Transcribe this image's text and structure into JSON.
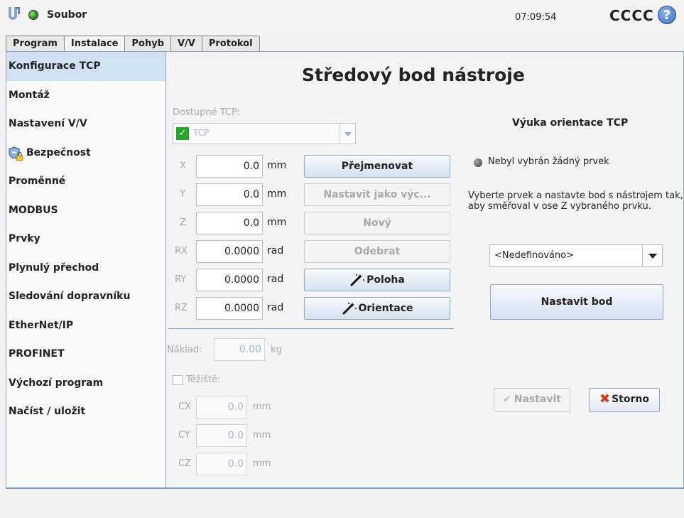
{
  "header": {
    "file_label": "Soubor",
    "clock": "07:09:54",
    "robot_name": "CCCC",
    "help_label": "?"
  },
  "tabs": [
    {
      "label": "Program",
      "active": false
    },
    {
      "label": "Instalace",
      "active": true
    },
    {
      "label": "Pohyb",
      "active": false
    },
    {
      "label": "V/V",
      "active": false
    },
    {
      "label": "Protokol",
      "active": false
    }
  ],
  "sidebar": {
    "items": [
      {
        "label": "Konfigurace TCP",
        "active": true
      },
      {
        "label": "Montáž"
      },
      {
        "label": "Nastavení V/V"
      },
      {
        "label": "Bezpečnost",
        "icon": "shield-lock-icon"
      },
      {
        "label": "Proměnné"
      },
      {
        "label": "MODBUS"
      },
      {
        "label": "Prvky"
      },
      {
        "label": "Plynulý přechod"
      },
      {
        "label": "Sledování dopravníku"
      },
      {
        "label": "EtherNet/IP"
      },
      {
        "label": "PROFINET"
      },
      {
        "label": "Výchozí program"
      },
      {
        "label": "Načíst / uložit"
      }
    ]
  },
  "main": {
    "title": "Středový bod nástroje",
    "tcp_label": "Dostupné TCP:",
    "tcp_value": "TCP",
    "coords": [
      {
        "axis": "X",
        "value": "0.0",
        "unit": "mm"
      },
      {
        "axis": "Y",
        "value": "0.0",
        "unit": "mm"
      },
      {
        "axis": "Z",
        "value": "0.0",
        "unit": "mm"
      },
      {
        "axis": "RX",
        "value": "0.0000",
        "unit": "rad"
      },
      {
        "axis": "RY",
        "value": "0.0000",
        "unit": "rad"
      },
      {
        "axis": "RZ",
        "value": "0.0000",
        "unit": "rad"
      }
    ],
    "buttons": {
      "rename": "Přejmenovat",
      "set_default": "Nastavit jako výc...",
      "new": "Nový",
      "remove": "Odebrat",
      "position": "Poloha",
      "orientation": "Orientace"
    },
    "payload_label": "Náklad:",
    "payload_value": "0.00",
    "payload_unit": "kg",
    "cog_label": "Těžiště:",
    "cog": [
      {
        "axis": "CX",
        "value": "0.0",
        "unit": "mm"
      },
      {
        "axis": "CY",
        "value": "0.0",
        "unit": "mm"
      },
      {
        "axis": "CZ",
        "value": "0.0",
        "unit": "mm"
      }
    ]
  },
  "teach": {
    "title": "Výuka orientace TCP",
    "no_feature": "Nebyl vybrán žádný prvek",
    "hint": "Vyberte prvek a nastavte bod s nástrojem tak, aby směřoval v ose Z vybraného prvku.",
    "feature_select": "<Nedefinováno>",
    "set_point": "Nastavit bod",
    "apply": "Nastavit",
    "cancel": "Storno"
  },
  "colors": {
    "accent": "#7f9cc0",
    "status_ok": "#3aa22a",
    "cancel_x": "#d23a1e"
  }
}
